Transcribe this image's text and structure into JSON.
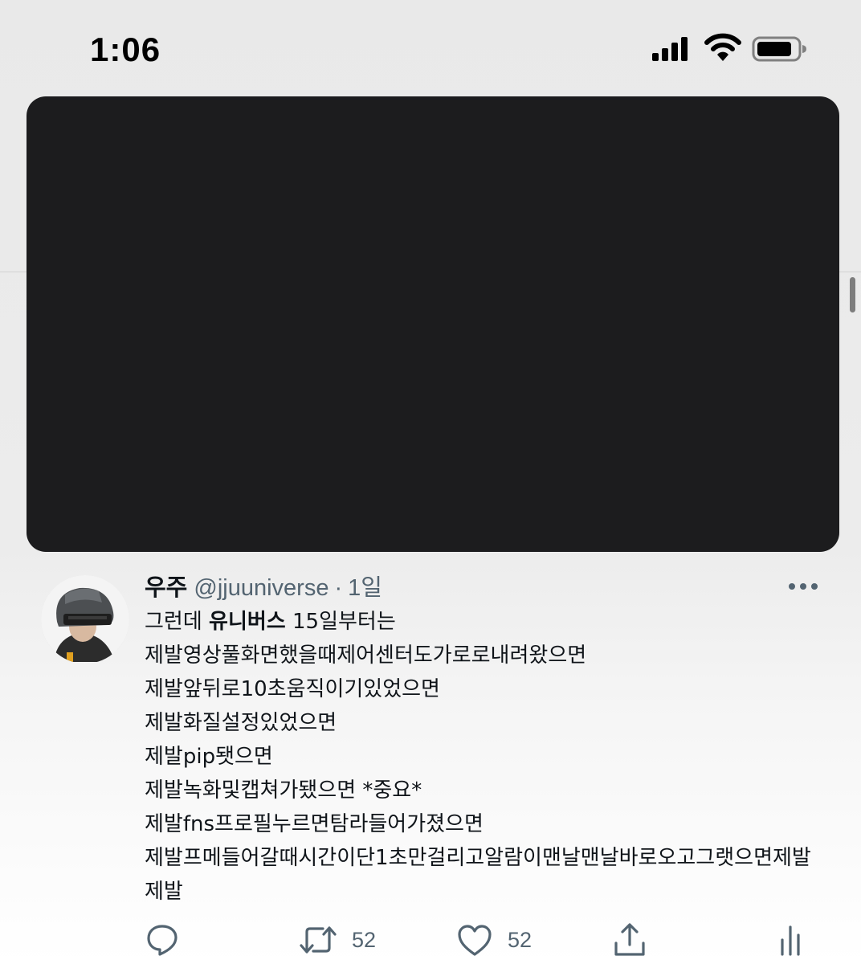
{
  "status_bar": {
    "time": "1:06",
    "icons": [
      "cellular-signal-icon",
      "wifi-icon",
      "battery-icon"
    ]
  },
  "video_player": {
    "state": "pip-overlay"
  },
  "tweet": {
    "display_name": "우주",
    "handle": "@jjuuniverse",
    "separator": "·",
    "timestamp": "1일",
    "body": {
      "line1_prefix": "그런데 ",
      "line1_mention": "유니버스",
      "line1_suffix": " 15일부터는",
      "lines": [
        "제발영상풀화면했을때제어센터도가로로내려왔으면",
        "제발앞뒤로10초움직이기있었으면",
        "제발화질설정있었으면",
        "제발pip됏으면",
        "제발녹화및캡쳐가됐으면 *중요*",
        "제발fns프로필누르면탐라들어가졌으면",
        "제발프메들어갈때시간이단1초만걸리고알람이맨날맨날바로오고그랫으면제발제발"
      ]
    },
    "actions": {
      "reply_count": "",
      "retweet_count": "52",
      "like_count": "52"
    }
  },
  "colors": {
    "text_primary": "#0f1419",
    "text_secondary": "#536471",
    "video_bg": "#1c1c1e"
  }
}
